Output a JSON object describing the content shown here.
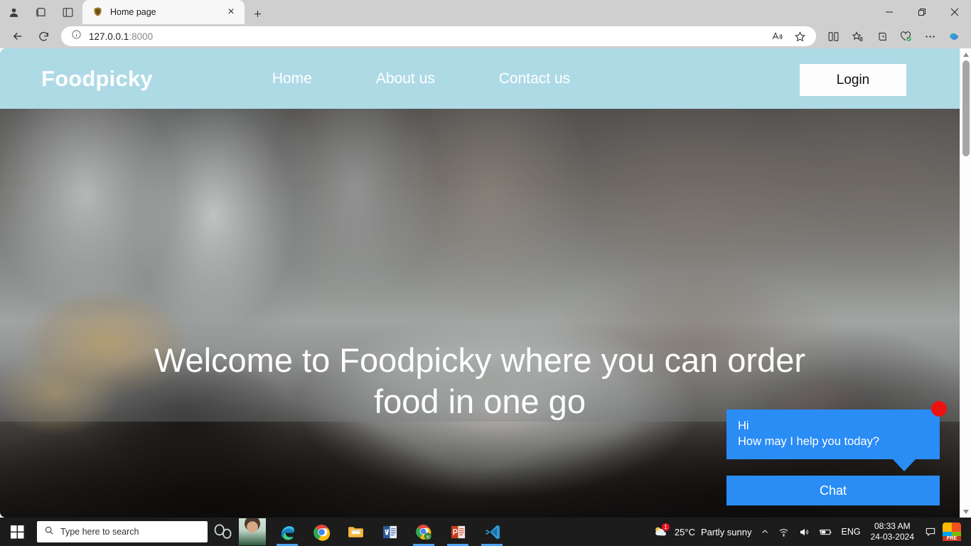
{
  "browser": {
    "tab": {
      "title": "Home page",
      "favicon": "shield-favicon"
    },
    "address": {
      "host": "127.0.0.1",
      "port": ":8000",
      "full": "127.0.0.1:8000"
    },
    "toolbar_icons": [
      "back-icon",
      "refresh-icon",
      "info-icon",
      "read-aloud-icon",
      "favorite-star-icon",
      "split-screen-icon",
      "favorites-icon",
      "collections-icon",
      "browser-essentials-icon",
      "settings-more-icon",
      "copilot-icon"
    ],
    "window_controls": [
      "minimize-icon",
      "restore-icon",
      "close-icon"
    ],
    "new_tab_label": "+",
    "close_tab_label": "×"
  },
  "site": {
    "brand": "Foodpicky",
    "nav": [
      {
        "label": "Home"
      },
      {
        "label": "About us"
      },
      {
        "label": "Contact us"
      }
    ],
    "login_label": "Login",
    "hero_title": "Welcome to Foodpicky where you can order food in one go",
    "header_bg": "#aedae6"
  },
  "chat": {
    "greeting_line1": "Hi",
    "greeting_line2": "How may I help you today?",
    "button_label": "Chat",
    "accent": "#2a8cf5",
    "badge_color": "#ee1111"
  },
  "taskbar": {
    "search_placeholder": "Type here to search",
    "apps": [
      {
        "name": "edge",
        "active": true
      },
      {
        "name": "chrome",
        "active": false
      },
      {
        "name": "file-explorer",
        "active": false
      },
      {
        "name": "word",
        "active": false
      },
      {
        "name": "chrome-node",
        "active": true
      },
      {
        "name": "powerpoint",
        "active": true
      },
      {
        "name": "vscode",
        "active": true
      }
    ],
    "weather": {
      "temperature": "25°C",
      "condition": "Partly sunny"
    },
    "language": "ENG",
    "time": "08:33 AM",
    "date": "24-03-2024",
    "tray_icons": [
      "show-hidden-icons-chevron",
      "wifi-icon",
      "volume-icon",
      "battery-icon",
      "notifications-icon",
      "pre-app-icon"
    ]
  }
}
